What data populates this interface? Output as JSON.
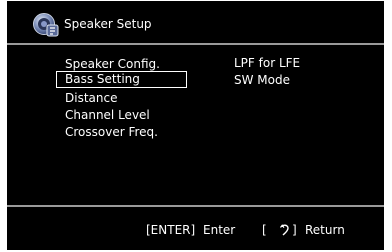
{
  "header": {
    "title": "Speaker Setup",
    "icon": "speaker-setup-icon"
  },
  "menu": {
    "items": [
      {
        "label": "Speaker Config.",
        "selected": false
      },
      {
        "label": "Bass Setting",
        "selected": true
      },
      {
        "label": "Distance",
        "selected": false
      },
      {
        "label": "Channel Level",
        "selected": false
      },
      {
        "label": "Crossover Freq.",
        "selected": false
      }
    ]
  },
  "submenu": {
    "items": [
      {
        "label": "LPF for LFE"
      },
      {
        "label": "SW Mode"
      }
    ]
  },
  "footer": {
    "enter_key": "[ENTER]",
    "enter_label": "Enter",
    "return_open": "[",
    "return_icon": "return-arrow-icon",
    "return_close": "]",
    "return_label": "Return"
  },
  "colors": {
    "background": "#000000",
    "text": "#ffffff",
    "divider": "#9a9a9a",
    "page": "#ffffff"
  }
}
